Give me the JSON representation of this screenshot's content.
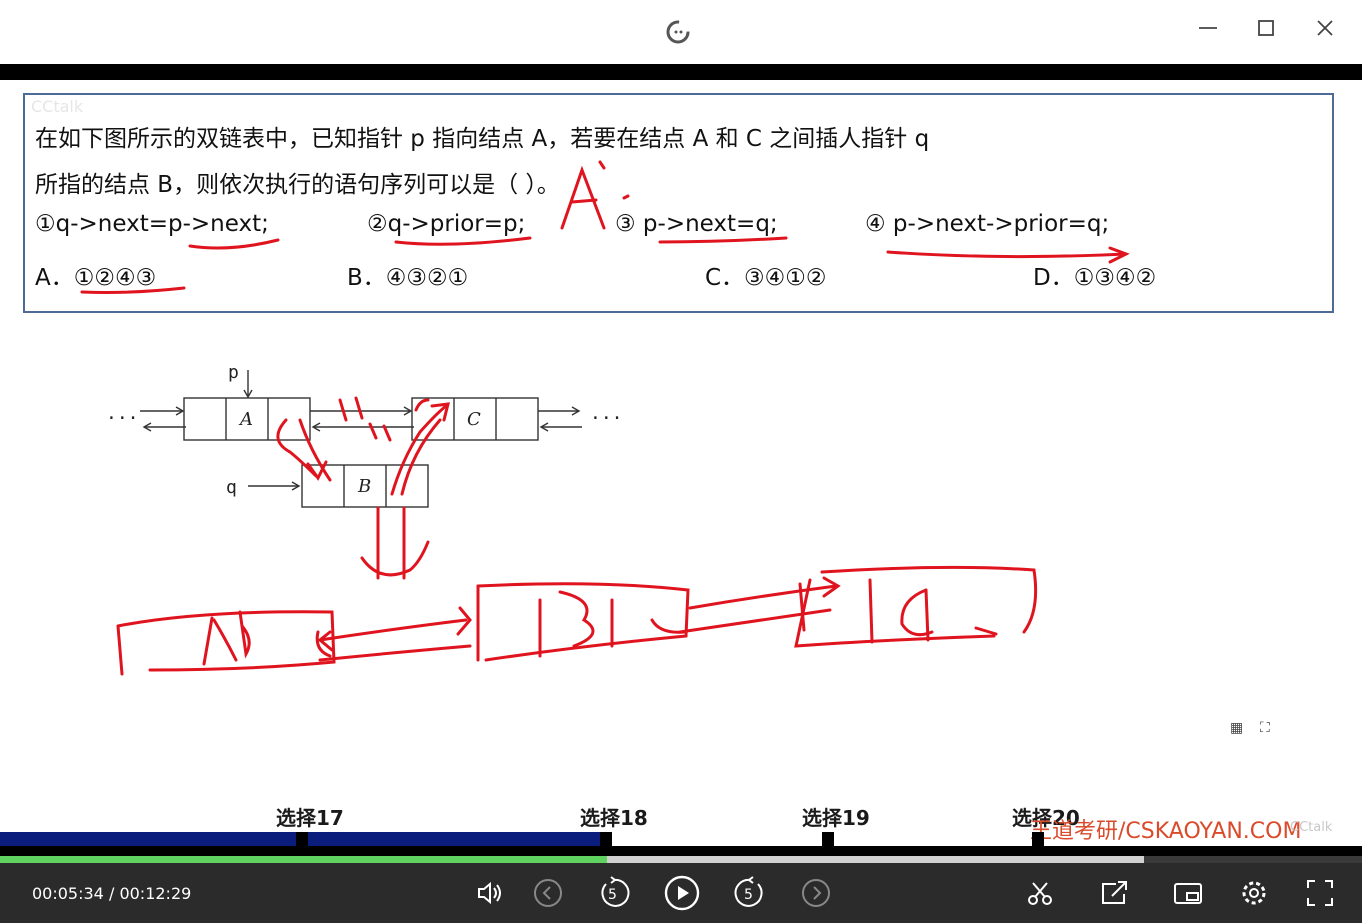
{
  "question": {
    "line1": "在如下图所示的双链表中，已知指针 p 指向结点 A，若要在结点 A 和 C 之间插人指针 q",
    "line2": "所指的结点 B，则依次执行的语句序列可以是（  ）。",
    "statements": [
      "①q->next=p->next;",
      "②q->prior=p;",
      "③ p->next=q;",
      "④ p->next->prior=q;"
    ],
    "options": [
      "A．①②④③",
      "B．④③②①",
      "C．③④①②",
      "D．①③④②"
    ],
    "watermark": "CCtalk"
  },
  "diagram": {
    "p_label": "p",
    "q_label": "q",
    "node_a": "A",
    "node_b": "B",
    "node_c": "C",
    "dots_left": "···",
    "dots_right": "···"
  },
  "annotation_answer": "A.",
  "chapters": [
    "选择17",
    "选择18",
    "选择19",
    "选择20"
  ],
  "site_watermark": "王道考研/CSKAOYAN.COM",
  "cctalk_watermark": "CCtalk",
  "player": {
    "current_time": "00:05:34",
    "separator": "/",
    "total_time": "00:12:29",
    "progress_fraction": 0.446,
    "buffered_fraction": 0.84,
    "skip_back_seconds": "5",
    "skip_forward_seconds": "5"
  },
  "colors": {
    "accent_green": "#5fd25f",
    "navy_bar": "#0a1d7d",
    "ink_red": "#e0141e",
    "box_border": "#4e6b96"
  },
  "icons": [
    "logo-icon",
    "minimize-icon",
    "maximize-icon",
    "close-icon",
    "volume-icon",
    "prev-chapter-icon",
    "rewind-5-icon",
    "play-icon",
    "forward-5-icon",
    "next-chapter-icon",
    "scissors-icon",
    "share-icon",
    "pip-icon",
    "settings-icon",
    "fullscreen-icon"
  ]
}
